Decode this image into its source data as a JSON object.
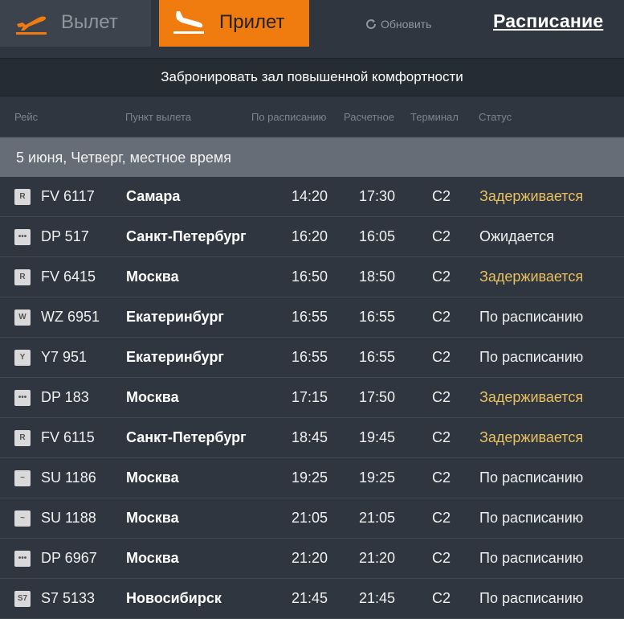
{
  "tabs": {
    "departure": "Вылет",
    "arrival": "Прилет"
  },
  "refresh_label": "Обновить",
  "schedule_label": "Расписание",
  "promo_text": "Забронировать зал повышенной комфортности",
  "columns": {
    "flight": "Рейс",
    "origin": "Пункт вылета",
    "scheduled": "По расписанию",
    "estimated": "Расчетное",
    "terminal": "Терминал",
    "status": "Статус"
  },
  "date_header": "5 июня, Четверг, местное время",
  "colors": {
    "accent": "#f07c0f",
    "delayed": "#e8c060"
  },
  "flights": [
    {
      "logo_icon": "airline-r-icon",
      "flight": "FV 6117",
      "city": "Самара",
      "scheduled": "14:20",
      "estimated": "17:30",
      "terminal": "C2",
      "status": "Задерживается",
      "delayed": true
    },
    {
      "logo_icon": "airline-dots-icon",
      "flight": "DP 517",
      "city": "Санкт-Петербург",
      "scheduled": "16:20",
      "estimated": "16:05",
      "terminal": "C2",
      "status": "Ожидается",
      "delayed": false
    },
    {
      "logo_icon": "airline-r-icon",
      "flight": "FV 6415",
      "city": "Москва",
      "scheduled": "16:50",
      "estimated": "18:50",
      "terminal": "C2",
      "status": "Задерживается",
      "delayed": true
    },
    {
      "logo_icon": "airline-wz-icon",
      "flight": "WZ 6951",
      "city": "Екатеринбург",
      "scheduled": "16:55",
      "estimated": "16:55",
      "terminal": "C2",
      "status": "По расписанию",
      "delayed": false
    },
    {
      "logo_icon": "airline-bird-icon",
      "flight": "Y7 951",
      "city": "Екатеринбург",
      "scheduled": "16:55",
      "estimated": "16:55",
      "terminal": "C2",
      "status": "По расписанию",
      "delayed": false
    },
    {
      "logo_icon": "airline-dots-icon",
      "flight": "DP 183",
      "city": "Москва",
      "scheduled": "17:15",
      "estimated": "17:50",
      "terminal": "C2",
      "status": "Задерживается",
      "delayed": true
    },
    {
      "logo_icon": "airline-r-icon",
      "flight": "FV 6115",
      "city": "Санкт-Петербург",
      "scheduled": "18:45",
      "estimated": "19:45",
      "terminal": "C2",
      "status": "Задерживается",
      "delayed": true
    },
    {
      "logo_icon": "airline-wing-icon",
      "flight": "SU 1186",
      "city": "Москва",
      "scheduled": "19:25",
      "estimated": "19:25",
      "terminal": "C2",
      "status": "По расписанию",
      "delayed": false
    },
    {
      "logo_icon": "airline-wing-icon",
      "flight": "SU 1188",
      "city": "Москва",
      "scheduled": "21:05",
      "estimated": "21:05",
      "terminal": "C2",
      "status": "По расписанию",
      "delayed": false
    },
    {
      "logo_icon": "airline-dots-icon",
      "flight": "DP 6967",
      "city": "Москва",
      "scheduled": "21:20",
      "estimated": "21:20",
      "terminal": "C2",
      "status": "По расписанию",
      "delayed": false
    },
    {
      "logo_icon": "airline-s7-icon",
      "flight": "S7 5133",
      "city": "Новосибирск",
      "scheduled": "21:45",
      "estimated": "21:45",
      "terminal": "C2",
      "status": "По расписанию",
      "delayed": false
    }
  ]
}
